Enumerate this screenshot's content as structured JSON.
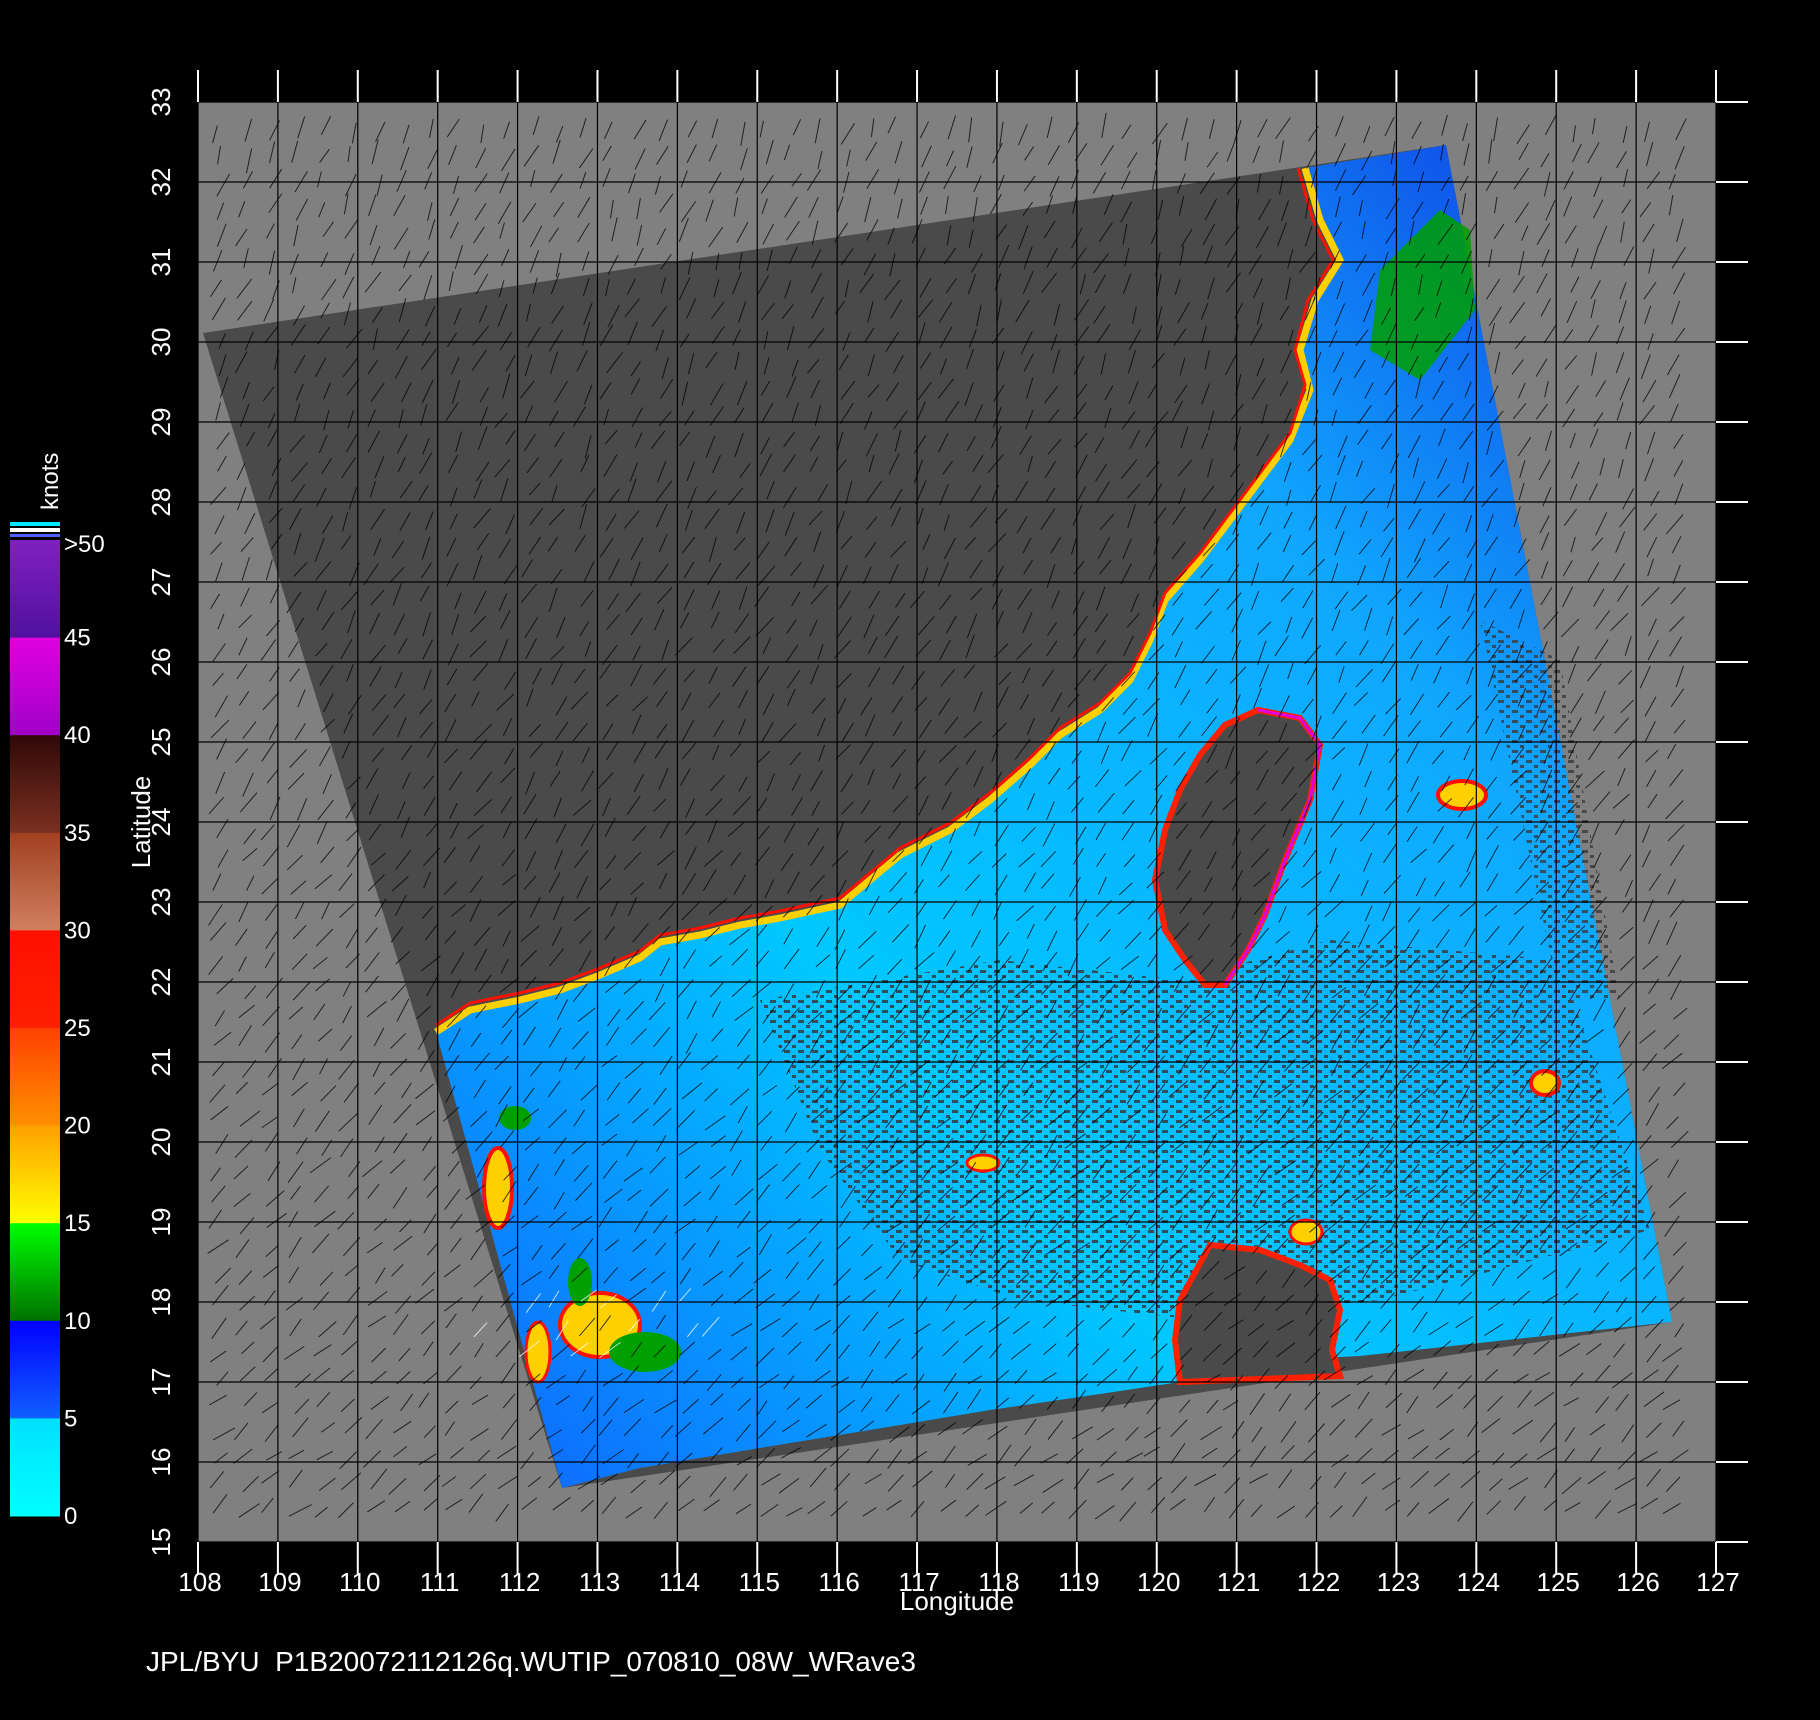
{
  "axes": {
    "xlabel": "Longitude",
    "ylabel": "Latitude",
    "xticks": [
      "108",
      "109",
      "110",
      "111",
      "112",
      "113",
      "114",
      "115",
      "116",
      "117",
      "118",
      "119",
      "120",
      "121",
      "122",
      "123",
      "124",
      "125",
      "126",
      "127"
    ],
    "yticks": [
      "15",
      "16",
      "17",
      "18",
      "19",
      "20",
      "21",
      "22",
      "23",
      "24",
      "25",
      "26",
      "27",
      "28",
      "29",
      "30",
      "31",
      "32",
      "33"
    ],
    "xlim": [
      108,
      127
    ],
    "ylim": [
      15,
      33
    ]
  },
  "colorbar": {
    "unit": "knots",
    "labels": [
      ">50",
      "45",
      "40",
      "35",
      "30",
      "25",
      "20",
      "15",
      "10",
      "5",
      "0"
    ],
    "levels": [
      50,
      45,
      40,
      35,
      30,
      25,
      20,
      15,
      10,
      5,
      0
    ]
  },
  "colors": {
    "background": "#000000",
    "no_data": "#808080",
    "land": "#4a4a4a",
    "ocean_low": "#00d8ff",
    "ocean_mid": "#1a50ff",
    "green": "#00a000",
    "yellow": "#ffe000",
    "red": "#ff1000",
    "magenta": "#e000e0",
    "purple": "#8000c0"
  },
  "footer": {
    "credit": "JPL/BYU  P1B20072112126q.WUTIP_070810_08W_WRave3"
  }
}
